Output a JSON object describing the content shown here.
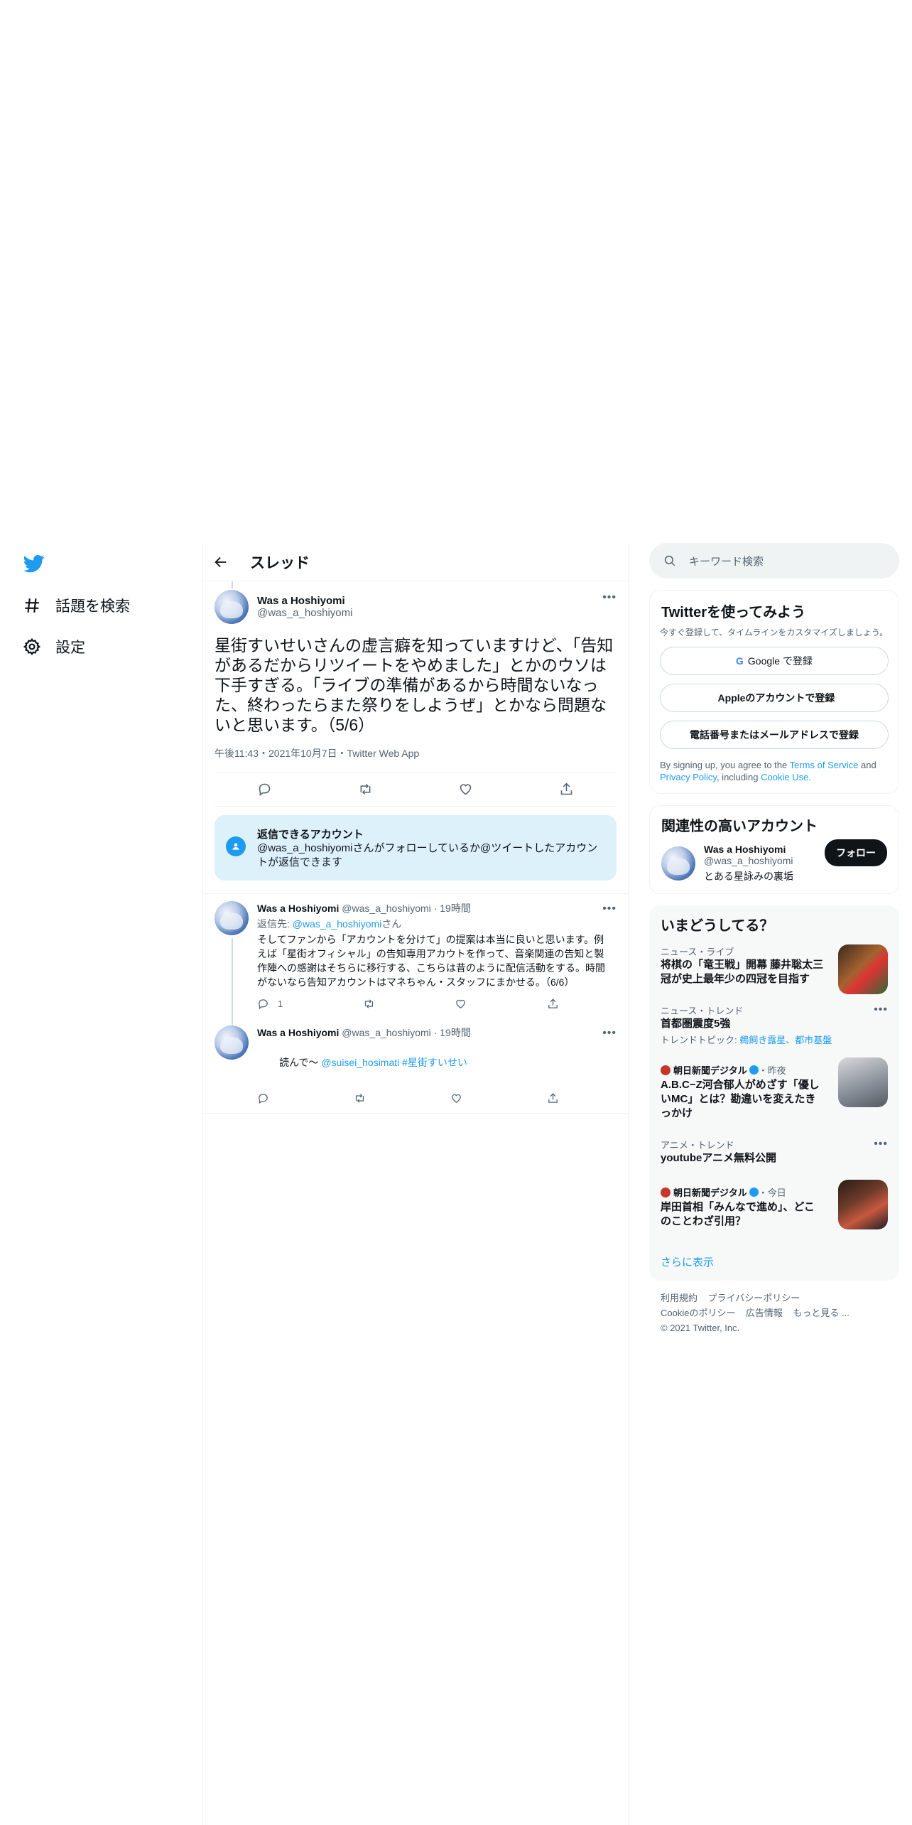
{
  "nav": {
    "items": [
      {
        "label": "話題を検索",
        "icon": "hashtag-icon"
      },
      {
        "label": "設定",
        "icon": "gear-icon"
      }
    ]
  },
  "header": {
    "title": "スレッド"
  },
  "focus_tweet": {
    "name": "Was a Hoshiyomi",
    "handle": "@was_a_hoshiyomi",
    "text": "星街すいせいさんの虚言癖を知っていますけど、「告知があるだからリツイートをやめました」とかのウソは下手すぎる。「ライブの準備があるから時間ないなった、終わったらまた祭りをしようぜ」とかなら問題ないと思います。（5/6）",
    "meta": "午後11:43・2021年10月7日・Twitter Web App"
  },
  "reply_notice": {
    "title": "返信できるアカウント",
    "text": "@was_a_hoshiyomiさんがフォローしているか@ツイートしたアカウントが返信できます"
  },
  "replies": [
    {
      "name": "Was a Hoshiyomi",
      "handle": "@was_a_hoshiyomi",
      "time": "19時間",
      "reply_prefix": "返信先: ",
      "reply_to": "@was_a_hoshiyomi",
      "reply_suffix": "さん",
      "text": "そしてファンから「アカウントを分けて」の提案は本当に良いと思います。例えば「星街オフィシャル」の告知専用アカウトを作って、音楽関連の告知と製作陣への感謝はそちらに移行する、こちらは昔のように配信活動をする。時間がないなら告知アカウントはマネちゃん・スタッフにまかせる。（6/6）",
      "reply_count": "1"
    },
    {
      "name": "Was a Hoshiyomi",
      "handle": "@was_a_hoshiyomi",
      "time": "19時間",
      "text_prefix": "読んで〜 ",
      "mention": "@suisei_hosimati",
      "hashtag": "#星街すいせい"
    }
  ],
  "search": {
    "placeholder": "キーワード検索"
  },
  "signup": {
    "title": "Twitterを使ってみよう",
    "subtitle": "今すぐ登録して、タイムラインをカスタマイズしましょう。",
    "google": "Google で登録",
    "apple": "Appleのアカウントで登録",
    "phone": "電話番号またはメールアドレスで登録",
    "terms_prefix": "By signing up, you agree to the ",
    "terms": "Terms of Service",
    "and": " and ",
    "privacy": "Privacy Policy",
    "including": ", including ",
    "cookie": "Cookie Use",
    "dot": "."
  },
  "related": {
    "title": "関連性の高いアカウント",
    "name": "Was a Hoshiyomi",
    "handle": "@was_a_hoshiyomi",
    "bio": "とある星詠みの裏垢",
    "follow": "フォロー"
  },
  "trends": {
    "title": "いまどうしてる？",
    "items": [
      {
        "context": "ニュース・ライブ",
        "title": "将棋の「竜王戦」開幕 藤井聡太三冠が史上最年少の四冠を目指す"
      },
      {
        "context": "ニュース・トレンド",
        "title": "首都圏震度5強",
        "topic_prefix": "トレンドトピック: ",
        "topics": "鵜飼き露星、都市基盤"
      },
      {
        "source": "朝日新聞デジタル",
        "time": "・昨夜",
        "title": "A.B.C−Z河合郁人がめざす「優しいMC」とは？勘違いを変えたきっかけ"
      },
      {
        "context": "アニメ・トレンド",
        "title": "youtubeアニメ無料公開"
      },
      {
        "source": "朝日新聞デジタル",
        "time": "・今日",
        "title": "岸田首相「みんなで進め」、どこのことわざ引用？"
      }
    ],
    "show_more": "さらに表示"
  },
  "footer": {
    "terms": "利用規約",
    "privacy": "プライバシーポリシー",
    "cookie": "Cookieのポリシー",
    "ads": "広告情報",
    "more": "もっと見る ...",
    "copyright": "© 2021 Twitter, Inc."
  },
  "colors": {
    "accent": "#1d9bf0",
    "text": "#0f1419",
    "muted": "#536471",
    "notice_bg": "#ddf1fb"
  }
}
